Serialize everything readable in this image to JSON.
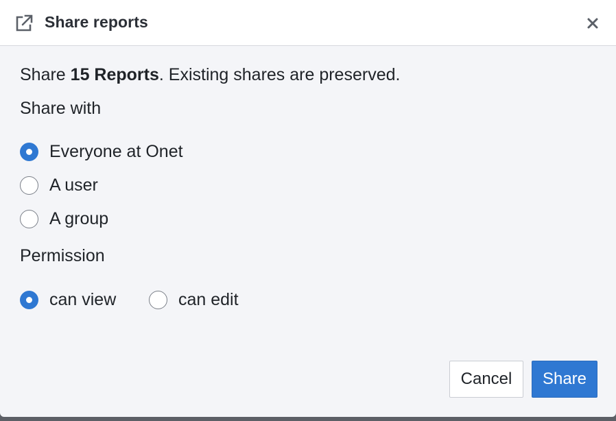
{
  "dialog": {
    "title": "Share reports",
    "header_icon": "external-link-icon",
    "close_icon": "close-icon"
  },
  "summary": {
    "prefix": "Share ",
    "count": "15 Reports",
    "suffix": ". Existing shares are preserved."
  },
  "share_with": {
    "label": "Share with",
    "options": [
      {
        "label": "Everyone at Onet",
        "checked": true
      },
      {
        "label": "A user",
        "checked": false
      },
      {
        "label": "A group",
        "checked": false
      }
    ]
  },
  "permission": {
    "label": "Permission",
    "options": [
      {
        "label": "can view",
        "checked": true
      },
      {
        "label": "can edit",
        "checked": false
      }
    ]
  },
  "buttons": {
    "cancel": "Cancel",
    "share": "Share"
  },
  "colors": {
    "accent": "#2f78d2",
    "background": "#f4f5f8",
    "header": "#ffffff"
  }
}
